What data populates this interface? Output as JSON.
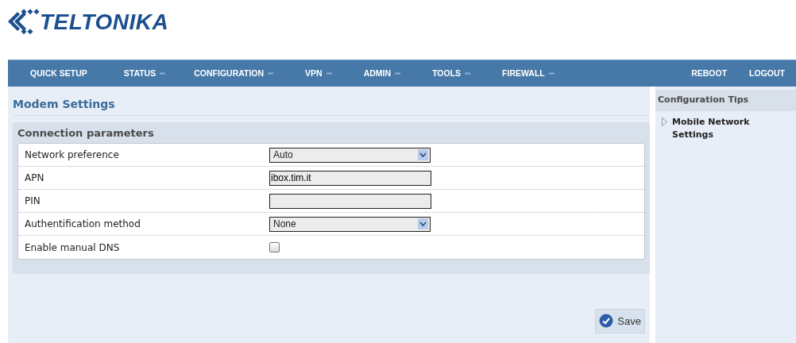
{
  "logo": {
    "text": "TELTONIKA"
  },
  "nav": {
    "left": [
      {
        "label": "QUICK SETUP",
        "dropdown": false
      },
      {
        "label": "STATUS",
        "dropdown": true
      },
      {
        "label": "CONFIGURATION",
        "dropdown": true
      },
      {
        "label": "VPN",
        "dropdown": true
      },
      {
        "label": "ADMIN",
        "dropdown": true
      },
      {
        "label": "TOOLS",
        "dropdown": true
      },
      {
        "label": "FIREWALL",
        "dropdown": true
      }
    ],
    "right": [
      {
        "label": "REBOOT",
        "dropdown": false
      },
      {
        "label": "LOGOUT",
        "dropdown": false
      }
    ]
  },
  "page_title": "Modem Settings",
  "section": {
    "title": "Connection parameters",
    "fields": [
      {
        "kind": "select",
        "label": "Network preference",
        "value": "Auto"
      },
      {
        "kind": "text",
        "label": "APN",
        "value": "ibox.tim.it"
      },
      {
        "kind": "text",
        "label": "PIN"
      },
      {
        "kind": "select",
        "label": "Authentification method",
        "value": "None"
      },
      {
        "kind": "checkbox",
        "label": "Enable manual DNS",
        "checked": false
      }
    ]
  },
  "save_button": "Save",
  "sidebar": {
    "title": "Configuration Tips",
    "items": [
      {
        "label": "Mobile Network Settings"
      }
    ]
  }
}
